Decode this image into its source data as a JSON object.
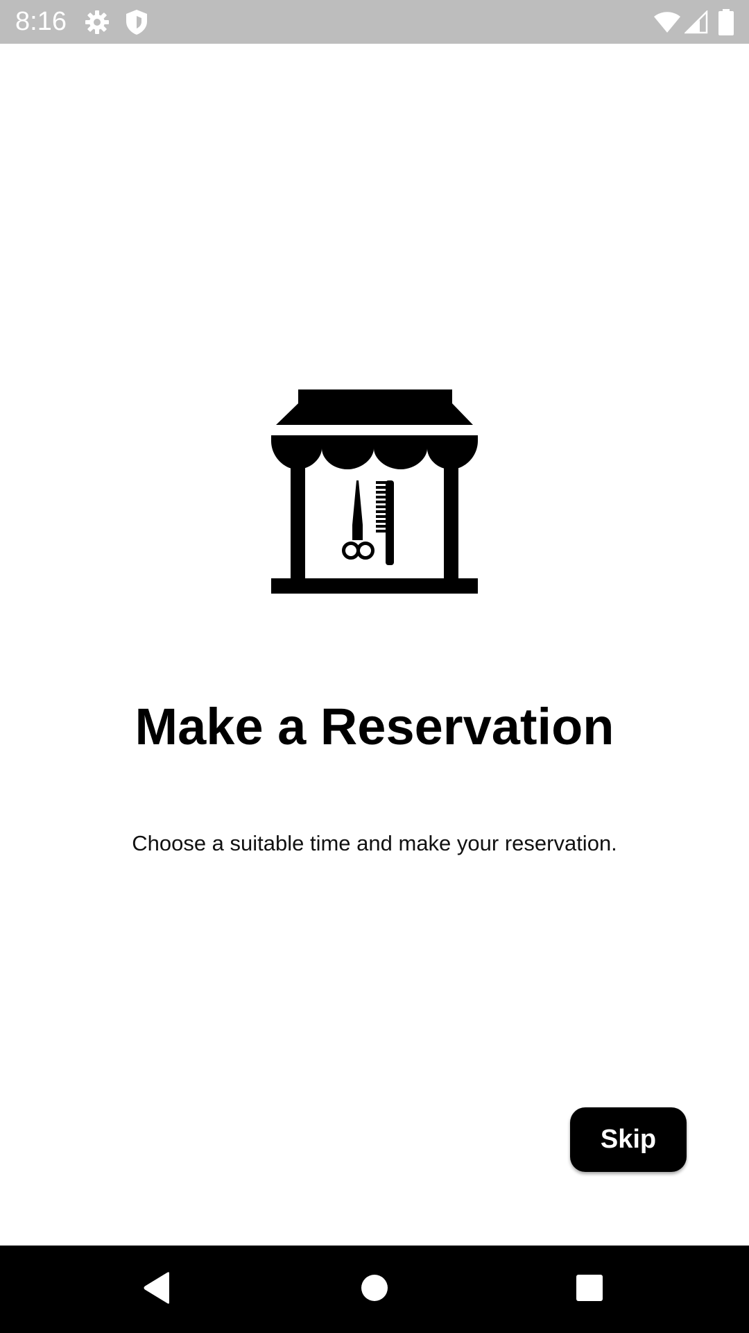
{
  "status_bar": {
    "time": "8:16",
    "icons": [
      "settings-gear-icon",
      "shield-icon",
      "wifi-icon",
      "cellular-signal-icon",
      "battery-icon"
    ],
    "background_color": "#bdbdbd"
  },
  "onboarding": {
    "illustration": "barbershop-storefront-icon",
    "title": "Make a Reservation",
    "subtitle": "Choose a suitable time and make your reservation."
  },
  "actions": {
    "skip_label": "Skip",
    "skip_color": "#000000"
  },
  "nav_bar": {
    "buttons": [
      "back-icon",
      "home-icon",
      "recents-icon"
    ],
    "background_color": "#000000"
  }
}
